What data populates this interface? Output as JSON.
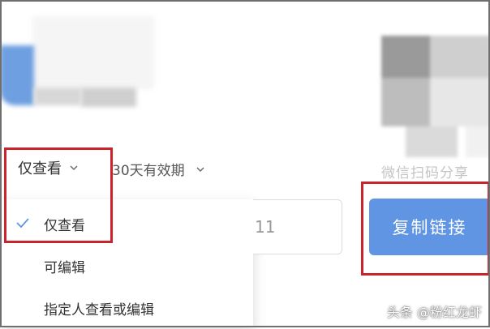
{
  "share_panel": {
    "permission_label": "仅查看",
    "expiry_label": "30天有效期",
    "qr_caption": "微信扫码分享",
    "link_fragment": "11",
    "copy_button_label": "复制链接"
  },
  "permission_menu": {
    "items": [
      {
        "label": "仅查看",
        "selected": true
      },
      {
        "label": "可编辑",
        "selected": false
      },
      {
        "label": "指定人查看或编辑",
        "selected": false
      }
    ]
  },
  "watermark": "头条 @粉红龙虾",
  "colors": {
    "accent_blue": "#5f95e2",
    "highlight_red": "#c9242b"
  }
}
